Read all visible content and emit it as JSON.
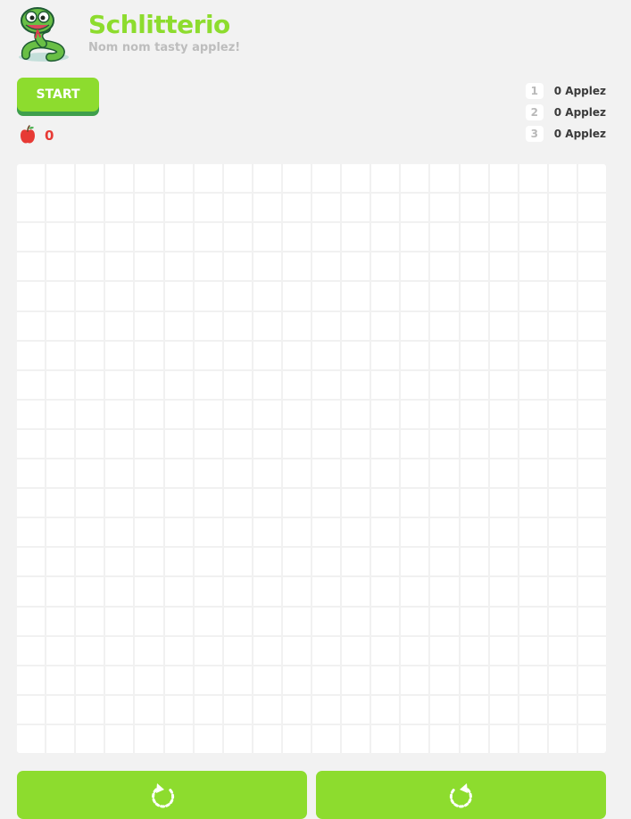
{
  "app": {
    "title": "Schlitterio",
    "subtitle": "Nom nom tasty applez!",
    "logo_icon": "snake-mascot-icon"
  },
  "controls": {
    "start_label": "START",
    "turn_left_icon": "rotate-counterclockwise-icon",
    "turn_right_icon": "rotate-clockwise-icon"
  },
  "score": {
    "value": "0",
    "icon": "apple-icon"
  },
  "leaderboard": [
    {
      "rank": "1",
      "score": "0 Applez"
    },
    {
      "rank": "2",
      "score": "0 Applez"
    },
    {
      "rank": "3",
      "score": "0 Applez"
    }
  ],
  "board": {
    "columns": 20,
    "rows": 20
  },
  "colors": {
    "brand_green": "#8ddc2e",
    "button_shadow": "#3f9f4c",
    "score_red": "#e73a35",
    "subtitle_gray": "#bdbdbd",
    "background": "#f2f2f2"
  }
}
